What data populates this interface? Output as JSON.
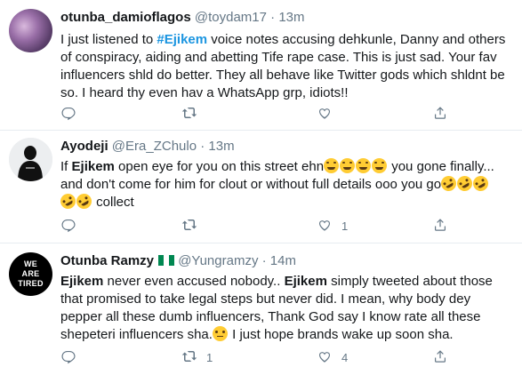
{
  "tweets": [
    {
      "name": "otunba_damioflagos",
      "handle": "@toydam17",
      "time": "13m",
      "text_lines": [
        [
          "I just listened to ",
          {
            "tag": "#Ejikem"
          },
          " voice notes accusing dehkunle, Danny and others"
        ],
        [
          "of conspiracy, aiding and abetting Tife rape case. This is just sad. Your fav"
        ],
        [
          "influencers shld do better. They all behave like Twitter gods which shldnt be"
        ],
        [
          "so. I heard thy even hav a WhatsApp grp, idiots!!"
        ]
      ],
      "reply_count": "",
      "retweet_count": "",
      "like_count": ""
    },
    {
      "name": "Ayodeji",
      "handle": "@Era_ZChulo",
      "time": "13m",
      "text_lines": [
        [
          "If ",
          {
            "kw": "Ejikem"
          },
          " open eye for you on this street ehn",
          {
            "emoji": "joy"
          },
          {
            "emoji": "joy"
          },
          {
            "emoji": "joy"
          },
          {
            "emoji": "joy"
          },
          " you gone finally..."
        ],
        [
          "and don't come for him for clout or without full details ooo you go",
          {
            "emoji": "rofl"
          },
          {
            "emoji": "rofl"
          },
          {
            "emoji": "rofl"
          }
        ],
        [
          {
            "emoji": "rofl"
          },
          {
            "emoji": "rofl"
          },
          " collect"
        ]
      ],
      "reply_count": "",
      "retweet_count": "",
      "like_count": "1"
    },
    {
      "name": "Otunba Ramzy",
      "handle": "@Yungramzy",
      "time": "14m",
      "avatar_text": [
        "WE",
        "ARE",
        "TIRED"
      ],
      "text_lines": [
        [
          {
            "kw": "Ejikem"
          },
          " never even accused nobody.. ",
          {
            "kw": "Ejikem"
          },
          " simply tweeted about those"
        ],
        [
          "that promised to take legal steps but never did. I mean, why body dey"
        ],
        [
          "pepper all these dumb influencers, Thank God say I know rate all these"
        ],
        [
          "shepeteri influencers sha.",
          {
            "emoji": "sad"
          },
          " I just hope brands wake up soon sha."
        ]
      ],
      "reply_count": "",
      "retweet_count": "1",
      "like_count": "4"
    }
  ],
  "separator": " · ",
  "icons": [
    "reply-icon",
    "retweet-icon",
    "like-icon",
    "share-icon"
  ],
  "colors": {
    "link": "#1b95e0",
    "muted": "#657786",
    "divider": "#e6ecf0"
  }
}
